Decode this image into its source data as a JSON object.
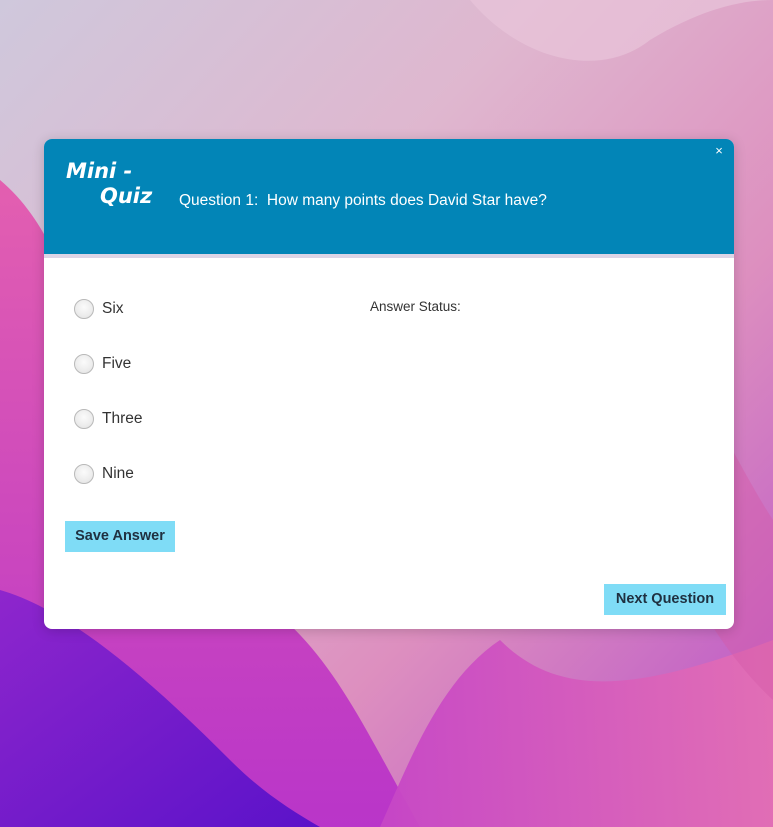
{
  "app": {
    "logo_line1": "Mini -",
    "logo_line2": "Quiz",
    "close_label": "×"
  },
  "question": {
    "text": "Question 1:  How many points does David Star have?"
  },
  "options": [
    {
      "label": "Six",
      "selected": false
    },
    {
      "label": "Five",
      "selected": false
    },
    {
      "label": "Three",
      "selected": false
    },
    {
      "label": "Nine",
      "selected": false
    }
  ],
  "status": {
    "label": "Answer Status:"
  },
  "buttons": {
    "save_label": "Save Answer",
    "next_label": "Next Question"
  },
  "colors": {
    "header": "#0285b7",
    "button": "#7fdcf6",
    "button_text": "#1f3040"
  },
  "icons": {
    "close": "close-icon",
    "radio": "radio-icon"
  }
}
